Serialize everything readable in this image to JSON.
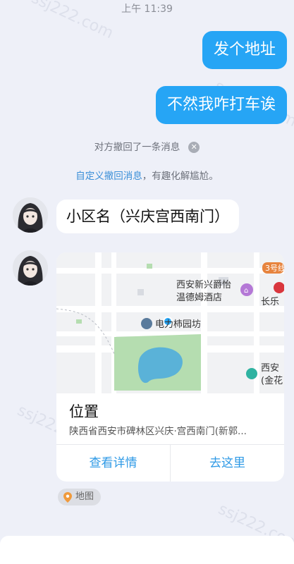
{
  "status": {
    "time": "上午 11:39"
  },
  "messages": {
    "out1": "发个地址",
    "out2": "不然我咋打车诶",
    "recall_notice": "对方撤回了一条消息",
    "custom_recall_link": "自定义撤回消息",
    "custom_recall_rest": "，有趣化解尴尬。",
    "in_text": "小区名（兴庆宫西南门）"
  },
  "location_card": {
    "title": "位置",
    "address": "陕西省西安市碑林区兴庆·宫西南门(新郭...",
    "view_details": "查看详情",
    "go_here": "去这里",
    "map_labels": {
      "hotel": "西安新兴爵怡温德姆酒店",
      "hotel_line1": "西安新兴爵怡",
      "hotel_line2": "温德姆酒店",
      "garden": "电力柿园坊",
      "metro": "3号线",
      "changle": "长乐",
      "xian_line1": "西安",
      "xian_line2": "(金花"
    },
    "colors": {
      "park": "#b5ddb0",
      "water": "#5ab2d8",
      "road": "#ffffff",
      "accent": "#26a5f5"
    }
  },
  "map_tag": {
    "label": "地图",
    "icon": "location-pin-icon"
  },
  "watermark": "ssj222.com"
}
